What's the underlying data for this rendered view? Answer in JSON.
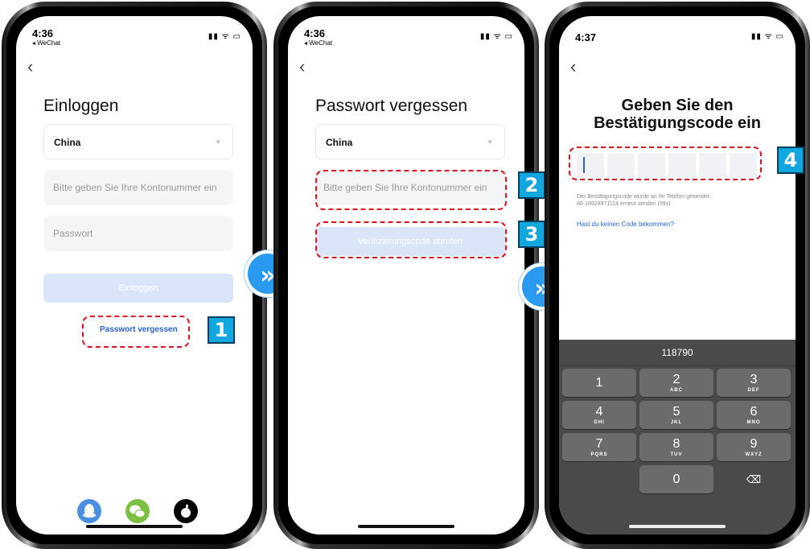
{
  "phones": [
    {
      "status": {
        "time": "4:36",
        "carrier": "◂ WeChat",
        "icons": "▮▮ ᯤ ▭"
      },
      "title": "Einloggen",
      "country": "China",
      "account_placeholder": "Bitte geben Sie Ihre Kontonummer ein",
      "password_placeholder": "Passwort",
      "login_button": "Einloggen",
      "forgot_link": "Passwort vergessen",
      "badge": "1",
      "social": [
        "qq-icon",
        "wechat-icon",
        "apple-icon"
      ]
    },
    {
      "status": {
        "time": "4:36",
        "carrier": "◂ WeChat",
        "icons": "▮▮ ᯤ ▭"
      },
      "title": "Passwort vergessen",
      "country": "China",
      "account_placeholder": "Bitte geben Sie Ihre Kontonummer ein",
      "verify_button": "Verifizierungscode abrufen",
      "badges": [
        "2",
        "3"
      ]
    },
    {
      "status": {
        "time": "4:37",
        "icons": "▮▮ ᯤ ▭"
      },
      "title_line1": "Geben Sie den",
      "title_line2": "Bestätigungscode ein",
      "badge": "4",
      "info_line1": "Der Bestätigungscode wurde an Ihr Telefon gesendet:",
      "info_line2": "86-18928971114 erneut senden (59s)",
      "no_code_link": "Hast du keinen Code bekommen?",
      "keyboard": {
        "suggestion": "118790",
        "keys": [
          {
            "num": "1",
            "sub": ""
          },
          {
            "num": "2",
            "sub": "ABC"
          },
          {
            "num": "3",
            "sub": "DEF"
          },
          {
            "num": "4",
            "sub": "GHI"
          },
          {
            "num": "5",
            "sub": "JKL"
          },
          {
            "num": "6",
            "sub": "MNO"
          },
          {
            "num": "7",
            "sub": "PQRS"
          },
          {
            "num": "8",
            "sub": "TUV"
          },
          {
            "num": "9",
            "sub": "WXYZ"
          },
          {
            "num": "0",
            "sub": ""
          },
          {
            "num": "⌫",
            "sub": ""
          }
        ]
      }
    }
  ],
  "arrows": [
    "»",
    "»"
  ],
  "colors": {
    "accent": "#2a62d8",
    "highlight": "#e0101a",
    "badge": "#13a7e0",
    "arrow": "#2a9af0"
  }
}
